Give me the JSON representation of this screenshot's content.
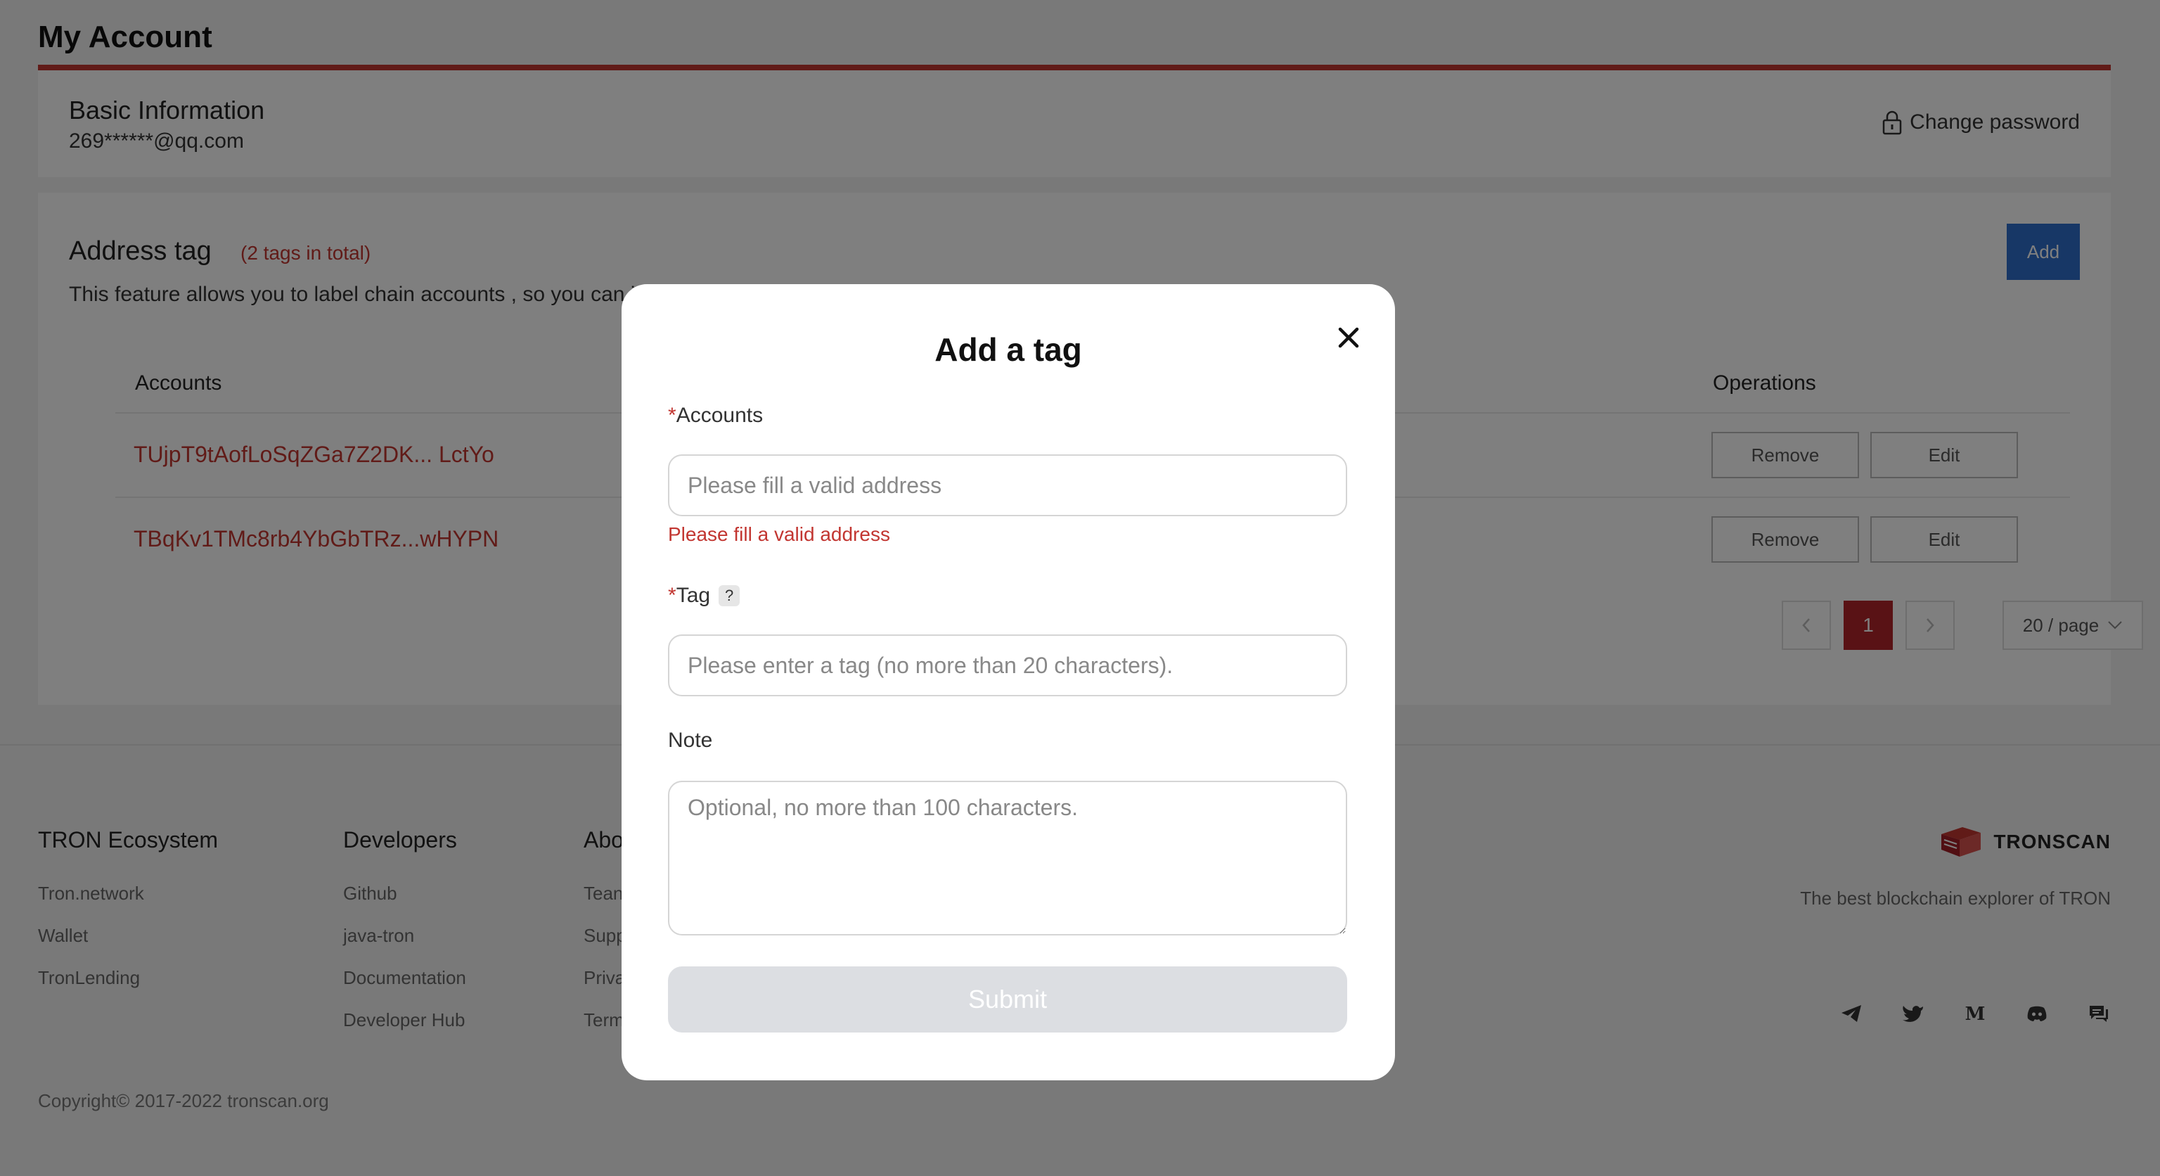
{
  "header": {
    "title": "My Account"
  },
  "basic": {
    "title": "Basic Information",
    "email": "269******@qq.com",
    "change_password": "Change password"
  },
  "address_tag": {
    "title": "Address tag",
    "count": "(2 tags in total)",
    "description": "This feature allows you to label chain accounts , so you can i",
    "add_label": "Add",
    "columns": {
      "accounts": "Accounts",
      "operations": "Operations"
    },
    "rows": [
      {
        "account": "TUjpT9tAofLoSqZGa7Z2DK...  LctYo",
        "remove": "Remove",
        "edit": "Edit"
      },
      {
        "account": "TBqKv1TMc8rb4YbGbTRz...wHYPN",
        "remove": "Remove",
        "edit": "Edit"
      }
    ],
    "pagination": {
      "current_page": "1",
      "page_size": "20 / page"
    }
  },
  "footer": {
    "col1": {
      "heading": "TRON Ecosystem",
      "links": [
        "Tron.network",
        "Wallet",
        "TronLending"
      ]
    },
    "col2": {
      "heading": "Developers",
      "links": [
        "Github",
        "java-tron",
        "Documentation",
        "Developer Hub"
      ]
    },
    "col3": {
      "heading": "Abo",
      "links": [
        "Tean",
        "Supp",
        "Priva",
        "Term"
      ]
    },
    "brand": "TRONSCAN",
    "tagline": "The best blockchain explorer of TRON",
    "socials": [
      "telegram-icon",
      "twitter-icon",
      "medium-icon",
      "discord-icon",
      "forum-icon"
    ],
    "copyright": "Copyright© 2017-2022 tronscan.org"
  },
  "modal": {
    "title": "Add a tag",
    "accounts_label": "Accounts",
    "accounts_placeholder": "Please fill a valid address",
    "accounts_error": "Please fill a valid address",
    "tag_label": "Tag",
    "tag_help": "?",
    "tag_placeholder": "Please enter a tag (no more than 20 characters).",
    "note_label": "Note",
    "note_placeholder": "Optional, no more than 100 characters.",
    "submit_label": "Submit",
    "required_mark": "*"
  },
  "colors": {
    "accent": "#c23631",
    "primary_button": "#2f6fcc",
    "disabled": "#dcdee2"
  }
}
